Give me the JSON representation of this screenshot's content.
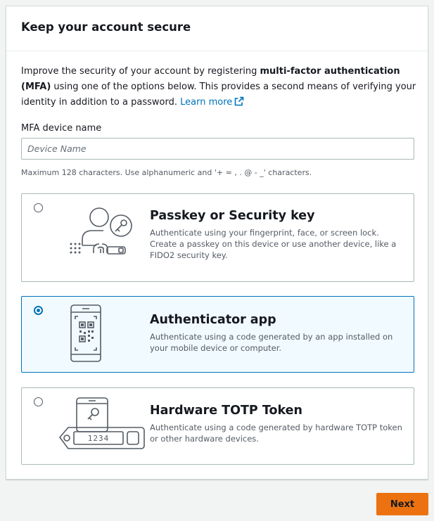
{
  "panel": {
    "title": "Keep your account secure",
    "intro_before": "Improve the security of your account by registering ",
    "intro_bold": "multi-factor authentication (MFA)",
    "intro_after": " using one of the options below. This provides a second means of verifying your identity in addition to a password. ",
    "learn_more": "Learn more",
    "field_label": "MFA device name",
    "field_placeholder": "Device Name",
    "field_value": "",
    "constraint": "Maximum 128 characters. Use alphanumeric and '+ = , . @ - _' characters."
  },
  "options": [
    {
      "title": "Passkey or Security key",
      "description": "Authenticate using your fingerprint, face, or screen lock. Create a passkey on this device or use another device, like a FIDO2 security key.",
      "selected": false,
      "icon": "user-key-fingerprint-icon"
    },
    {
      "title": "Authenticator app",
      "description": "Authenticate using a code generated by an app installed on your mobile device or computer.",
      "selected": true,
      "icon": "phone-qr-code-icon"
    },
    {
      "title": "Hardware TOTP Token",
      "description": "Authenticate using a code generated by hardware TOTP token or other hardware devices.",
      "selected": false,
      "icon": "hardware-token-icon",
      "token_display": "1234"
    }
  ],
  "footer": {
    "next_label": "Next"
  },
  "colors": {
    "accent": "#0073bb",
    "primary_button": "#ec7211",
    "selected_bg": "#f1faff"
  }
}
